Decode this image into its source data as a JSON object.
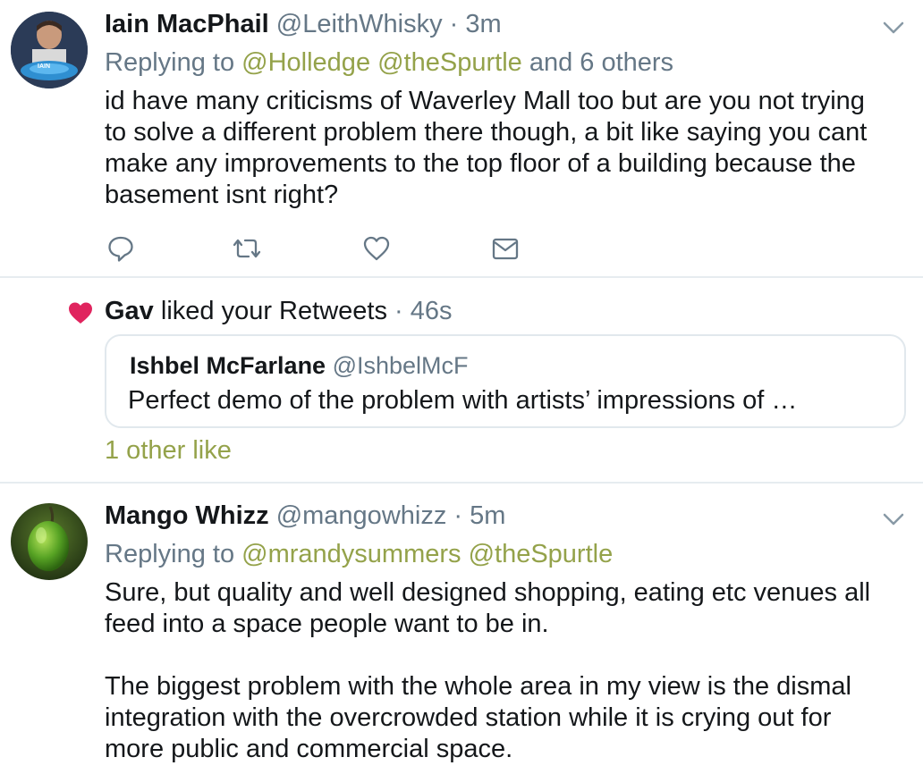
{
  "tweet1": {
    "name": "Iain MacPhail",
    "handle": "@LeithWhisky",
    "time": "· 3m",
    "replying_prefix": "Replying to",
    "replying_mentions": "@Holledge @theSpurtle",
    "replying_suffix": "and 6 others",
    "text": "id have many criticisms of Waverley Mall too but are you not trying to solve a different problem there though, a bit like saying you cant make any improvements to the top floor of a building because the basement isnt right?",
    "avatar_badge": "IAIN",
    "actions": [
      "reply-icon",
      "retweet-icon",
      "like-icon",
      "direct-message-icon"
    ]
  },
  "notification": {
    "icon": "heart-icon",
    "name": "Gav",
    "text": "liked your Retweets",
    "time": "· 46s",
    "quoted": {
      "name": "Ishbel McFarlane",
      "handle": "@IshbelMcF",
      "text": "Perfect demo of the problem with artists’ impressions of …"
    },
    "other_likes": "1 other like"
  },
  "tweet2": {
    "name": "Mango Whizz",
    "handle": "@mangowhizz",
    "time": "· 5m",
    "replying_prefix": "Replying to",
    "replying_mentions": "@mrandysummers @theSpurtle",
    "text": "Sure, but quality and well designed shopping, eating etc venues all feed into a space people want to be in.\n\nThe biggest problem with the whole area in my view is the dismal integration with the overcrowded station while it is crying out for more public and commercial space."
  },
  "colors": {
    "accent_green": "#94a24a",
    "muted_gray": "#657786",
    "heart_red": "#e0245e",
    "divider": "#e6ecf0"
  }
}
